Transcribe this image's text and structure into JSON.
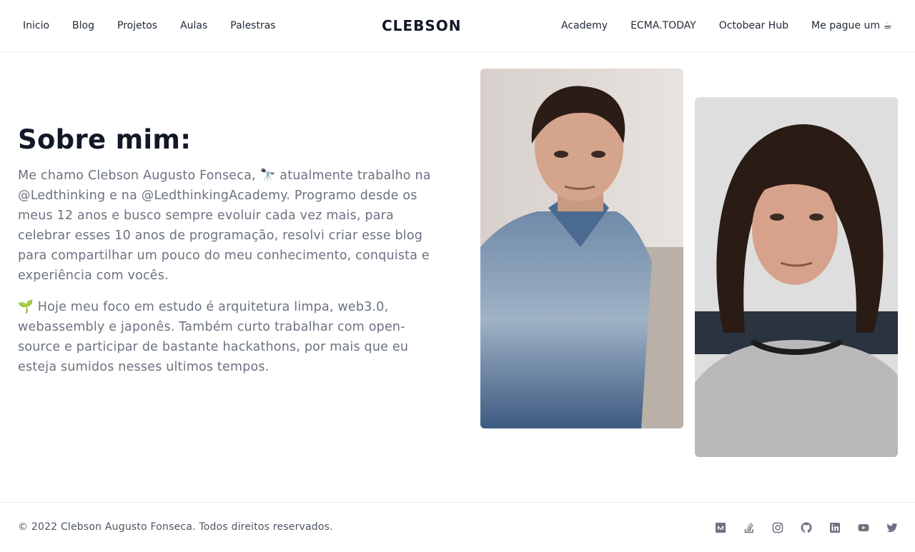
{
  "nav": {
    "left": [
      "Inicio",
      "Blog",
      "Projetos",
      "Aulas",
      "Palestras"
    ],
    "brand": "CLEBSON",
    "right": [
      "Academy",
      "ECMA.TODAY",
      "Octobear Hub",
      "Me pague um ☕"
    ]
  },
  "about": {
    "title": "Sobre mim:",
    "paragraph1": "Me chamo Clebson Augusto Fonseca, 🔭 atualmente trabalho na @Ledthinking e na @LedthinkingAcademy. Programo desde os meus 12 anos e busco sempre evoluir cada vez mais, para celebrar esses 10 anos de programação, resolvi criar esse blog para compartilhar um pouco do meu conhecimento, conquista e experiência com vocês.",
    "paragraph2": "🌱 Hoje meu foco em estudo é arquitetura limpa, web3.0, webassembly e japonês. Também curto trabalhar com open-source e participar de bastante hackathons, por mais que eu esteja sumidos nesses ultimos tempos."
  },
  "footer": {
    "copyright": "© 2022 Clebson Augusto Fonseca. Todos direitos reservados.",
    "social_icons": [
      "medium-icon",
      "stackoverflow-icon",
      "instagram-icon",
      "github-icon",
      "linkedin-icon",
      "youtube-icon",
      "twitter-icon"
    ]
  },
  "colors": {
    "heading": "#111827",
    "body_text": "#6b7280",
    "nav_text": "#1f2937",
    "border": "#e5e7eb"
  }
}
